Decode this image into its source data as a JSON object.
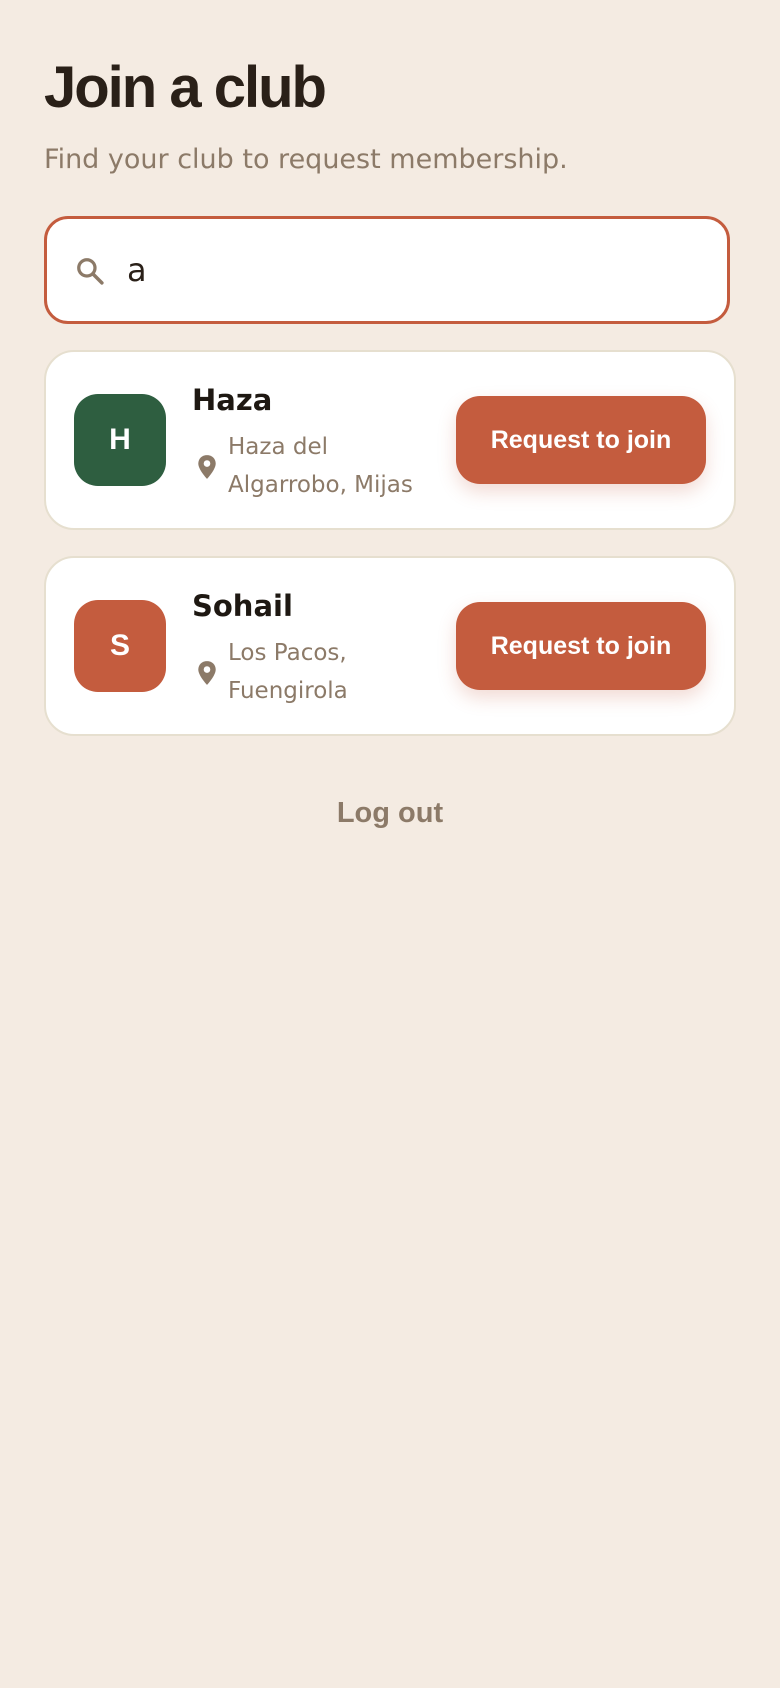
{
  "header": {
    "title": "Join a club",
    "subtitle": "Find your club to request membership."
  },
  "search": {
    "value": "a",
    "icon": "search-icon"
  },
  "clubs": [
    {
      "initial": "H",
      "name": "Haza",
      "location_line1": "Haza del",
      "location_line2": "Algarrobo, Mijas",
      "avatar_color": "#2e5e40",
      "button_label": "Request to join"
    },
    {
      "initial": "S",
      "name": "Sohail",
      "location_line1": "Los Pacos,",
      "location_line2": "Fuengirola",
      "avatar_color": "#c45c3e",
      "button_label": "Request to join"
    }
  ],
  "footer": {
    "logout_label": "Log out"
  },
  "colors": {
    "background": "#f4ebe2",
    "accent": "#c45c3e",
    "muted_text": "#8c7a68"
  }
}
